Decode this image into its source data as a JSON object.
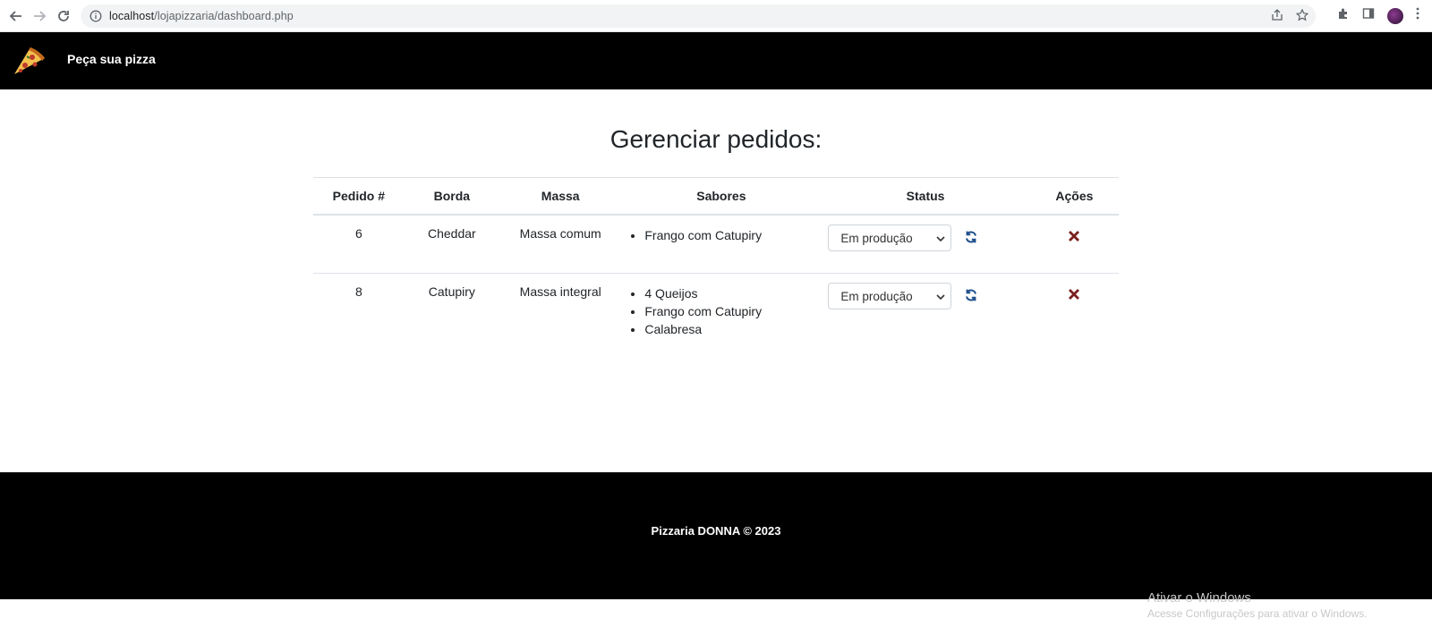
{
  "browser": {
    "url_host": "localhost",
    "url_path": "/lojapizzaria/dashboard.php"
  },
  "header": {
    "brand": "Peça sua pizza",
    "logo_icon": "pizza-slice-icon"
  },
  "main": {
    "title": "Gerenciar pedidos:",
    "columns": [
      "Pedido #",
      "Borda",
      "Massa",
      "Sabores",
      "Status",
      "Ações"
    ],
    "orders": [
      {
        "id": "6",
        "borda": "Cheddar",
        "massa": "Massa comum",
        "sabores": [
          "Frango com Catupiry"
        ],
        "status": "Em produção"
      },
      {
        "id": "8",
        "borda": "Catupiry",
        "massa": "Massa integral",
        "sabores": [
          "4 Queijos",
          "Frango com Catupiry",
          "Calabresa"
        ],
        "status": "Em produção"
      }
    ]
  },
  "footer": {
    "text": "Pizzaria DONNA © 2023"
  },
  "watermark": {
    "title": "Ativar o Windows",
    "subtitle": "Acesse Configurações para ativar o Windows."
  },
  "colors": {
    "header_bg": "#000000",
    "refresh_icon": "#1f4e8c",
    "delete_icon": "#7a1f1f"
  }
}
